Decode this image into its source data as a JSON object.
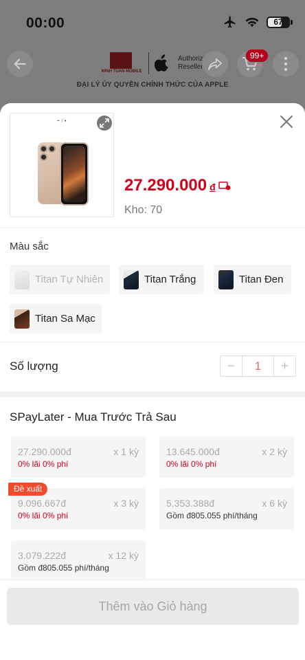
{
  "status_bar": {
    "time": "00:00",
    "battery": "67"
  },
  "header": {
    "cart_badge": "99+",
    "brand_small": "MINH TUAN MOBILE",
    "brand_auth": [
      "Authorized",
      "Reseller"
    ],
    "tagline": "ĐẠI LÝ ỦY QUYỀN CHÍNH THỨC CỦA APPLE"
  },
  "product": {
    "price": "27.290.000",
    "currency": "đ",
    "stock": "Kho: 70"
  },
  "color_section": {
    "label": "Màu sắc",
    "options": [
      {
        "label": "Titan Tự Nhiên",
        "state": "disabled"
      },
      {
        "label": "Titan Trắng",
        "state": "available"
      },
      {
        "label": "Titan Đen",
        "state": "available"
      },
      {
        "label": "Titan Sa Mạc",
        "state": "available"
      }
    ]
  },
  "quantity": {
    "label": "Số lượng",
    "value": "1",
    "minus": "−",
    "plus": "+"
  },
  "spaylater": {
    "title": "SPayLater - Mua Trước Trả Sau",
    "recommended_tag": "Đề xuất",
    "plans": [
      {
        "amount": "27.290.000đ",
        "term": "x 1 kỳ",
        "note": "0% lãi 0% phí"
      },
      {
        "amount": "13.645.000đ",
        "term": "x 2 kỳ",
        "note": "0% lãi 0% phí"
      },
      {
        "amount": "9.096.667đ",
        "term": "x 3 kỳ",
        "note": "0% lãi 0% phí"
      },
      {
        "amount": "5.353.388đ",
        "term": "x 6 kỳ",
        "note": "Gồm đ805.055 phí/tháng"
      },
      {
        "amount": "3.079.222đ",
        "term": "x 12 kỳ",
        "note": "Gồm đ805.055 phí/tháng"
      }
    ]
  },
  "actions": {
    "add_to_cart": "Thêm vào Giỏ hàng"
  },
  "colors": {
    "accent": "#d0011b",
    "tag": "#ef4b2c",
    "overlay": "#7d7d7d"
  }
}
